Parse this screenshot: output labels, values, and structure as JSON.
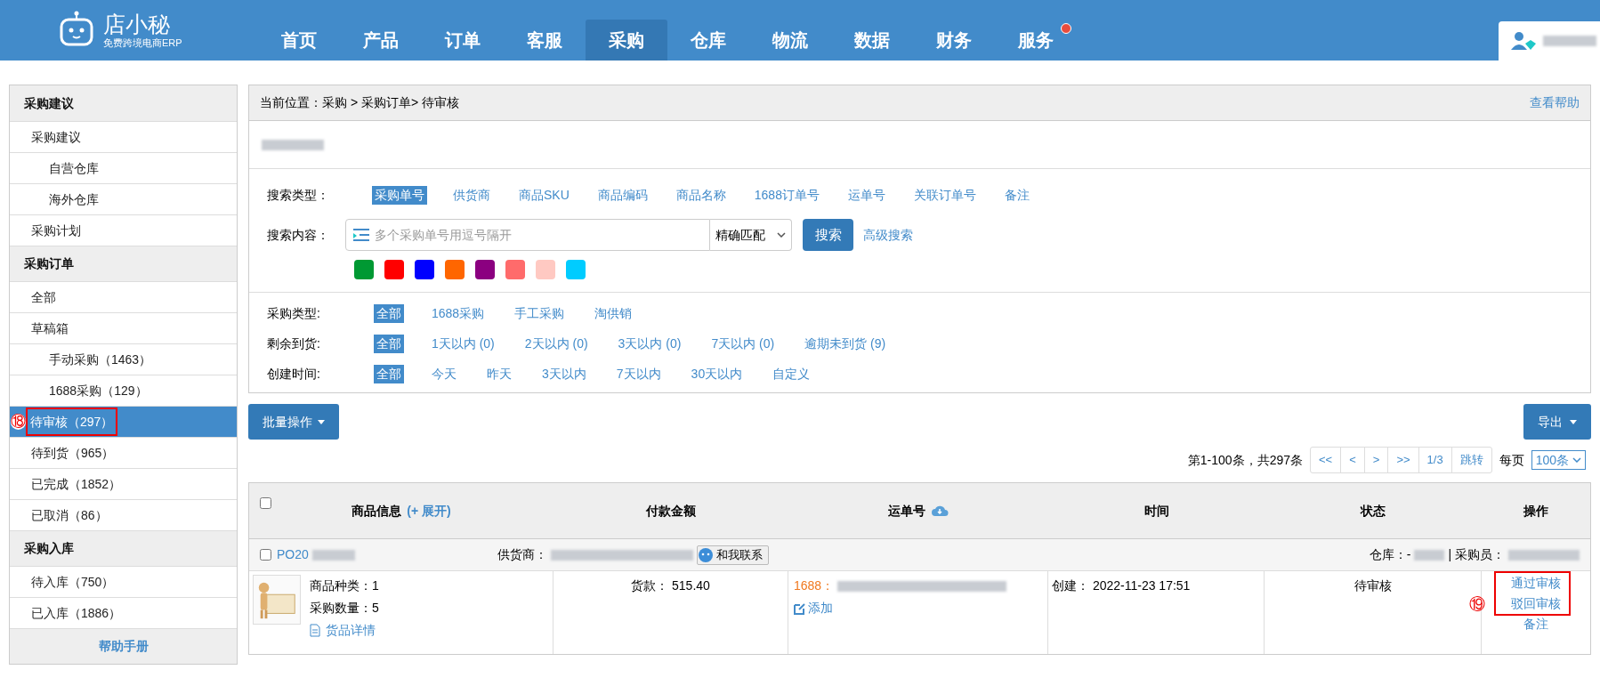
{
  "header": {
    "logo": {
      "name": "店小秘",
      "tagline": "免费跨境电商ERP"
    },
    "nav": [
      {
        "label": "首页",
        "selected": false,
        "notification": false
      },
      {
        "label": "产品",
        "selected": false,
        "notification": false
      },
      {
        "label": "订单",
        "selected": false,
        "notification": false
      },
      {
        "label": "客服",
        "selected": false,
        "notification": false
      },
      {
        "label": "采购",
        "selected": true,
        "notification": false
      },
      {
        "label": "仓库",
        "selected": false,
        "notification": false
      },
      {
        "label": "物流",
        "selected": false,
        "notification": false
      },
      {
        "label": "数据",
        "selected": false,
        "notification": false
      },
      {
        "label": "财务",
        "selected": false,
        "notification": false
      },
      {
        "label": "服务",
        "selected": false,
        "notification": true
      }
    ]
  },
  "sidebar": {
    "sections": [
      {
        "title": "采购建议",
        "items": [
          {
            "label": "采购建议",
            "selected": false,
            "children": [
              {
                "label": "自营仓库",
                "selected": false
              },
              {
                "label": "海外仓库",
                "selected": false
              }
            ]
          },
          {
            "label": "采购计划",
            "selected": false
          }
        ]
      },
      {
        "title": "采购订单",
        "items": [
          {
            "label": "全部",
            "selected": false
          },
          {
            "label": "草稿箱",
            "selected": false,
            "children": [
              {
                "label": "手动采购（1463）",
                "selected": false
              },
              {
                "label": "1688采购（129）",
                "selected": false
              }
            ]
          },
          {
            "label": "待审核（297）",
            "selected": true,
            "annotation": "⑱"
          },
          {
            "label": "待到货（965）",
            "selected": false
          },
          {
            "label": "已完成（1852）",
            "selected": false
          },
          {
            "label": "已取消（86）",
            "selected": false
          }
        ]
      },
      {
        "title": "采购入库",
        "items": [
          {
            "label": "待入库（750）",
            "selected": false
          },
          {
            "label": "已入库（1886）",
            "selected": false
          }
        ]
      }
    ],
    "footer": "帮助手册"
  },
  "breadcrumb": {
    "label": "当前位置：",
    "path": "采购 > 采购订单> 待审核",
    "help": "查看帮助"
  },
  "search": {
    "type_label": "搜索类型：",
    "types": [
      {
        "label": "采购单号",
        "selected": true
      },
      {
        "label": "供货商",
        "selected": false
      },
      {
        "label": "商品SKU",
        "selected": false
      },
      {
        "label": "商品编码",
        "selected": false
      },
      {
        "label": "商品名称",
        "selected": false
      },
      {
        "label": "1688订单号",
        "selected": false
      },
      {
        "label": "运单号",
        "selected": false
      },
      {
        "label": "关联订单号",
        "selected": false
      },
      {
        "label": "备注",
        "selected": false
      }
    ],
    "content_label": "搜索内容：",
    "placeholder": "多个采购单号用逗号隔开",
    "match": "精确匹配",
    "button": "搜索",
    "advanced": "高级搜索",
    "colors": [
      {
        "color": "#009933"
      },
      {
        "color": "#ff0000"
      },
      {
        "color": "#0000ff"
      },
      {
        "color": "#ff6600"
      },
      {
        "color": "#8b0080"
      },
      {
        "color": "#ff6b6b"
      },
      {
        "color": "#ffc9c2"
      },
      {
        "color": "#00ccff"
      }
    ]
  },
  "filters": [
    {
      "label": "采购类型:",
      "options": [
        {
          "label": "全部",
          "selected": true
        },
        {
          "label": "1688采购",
          "selected": false
        },
        {
          "label": "手工采购",
          "selected": false
        },
        {
          "label": "淘供销",
          "selected": false
        }
      ]
    },
    {
      "label": "剩余到货:",
      "options": [
        {
          "label": "全部",
          "selected": true
        },
        {
          "label": "1天以内 (0)",
          "selected": false
        },
        {
          "label": "2天以内 (0)",
          "selected": false
        },
        {
          "label": "3天以内 (0)",
          "selected": false
        },
        {
          "label": "7天以内 (0)",
          "selected": false
        },
        {
          "label": "逾期未到货 (9)",
          "selected": false
        }
      ]
    },
    {
      "label": "创建时间:",
      "options": [
        {
          "label": "全部",
          "selected": true
        },
        {
          "label": "今天",
          "selected": false
        },
        {
          "label": "昨天",
          "selected": false
        },
        {
          "label": "3天以内",
          "selected": false
        },
        {
          "label": "7天以内",
          "selected": false
        },
        {
          "label": "30天以内",
          "selected": false
        },
        {
          "label": "自定义",
          "selected": false
        }
      ]
    }
  ],
  "toolbar": {
    "batch": "批量操作",
    "export": "导出"
  },
  "pagination": {
    "summary": "第1-100条，共297条",
    "buttons": [
      "<<",
      "<",
      ">",
      ">>",
      "1/3",
      "跳转"
    ],
    "per_page_label": "每页",
    "per_page": "100条"
  },
  "table": {
    "select_all_checked": false,
    "columns": [
      {
        "label": "商品信息",
        "extra": "(+ 展开)"
      },
      {
        "label": "付款金额"
      },
      {
        "label": "运单号"
      },
      {
        "label": "时间"
      },
      {
        "label": "状态"
      },
      {
        "label": "操作"
      }
    ],
    "order": {
      "checked": false,
      "id": "PO20",
      "supplier_label": "供货商：",
      "contact": "和我联系",
      "warehouse_label": "仓库：-",
      "buyer_label": "| 采购员："
    },
    "item": {
      "kinds": "商品种类：1",
      "quantity": "采购数量：5",
      "details": "货品详情",
      "payment": "货款：  515.40",
      "tracking_prefix": "1688：",
      "add": "添加",
      "created": "创建：  2022-11-23 17:51",
      "status": "待审核",
      "actions": [
        "通过审核",
        "驳回审核",
        "备注"
      ],
      "annotation": "⑲"
    }
  }
}
